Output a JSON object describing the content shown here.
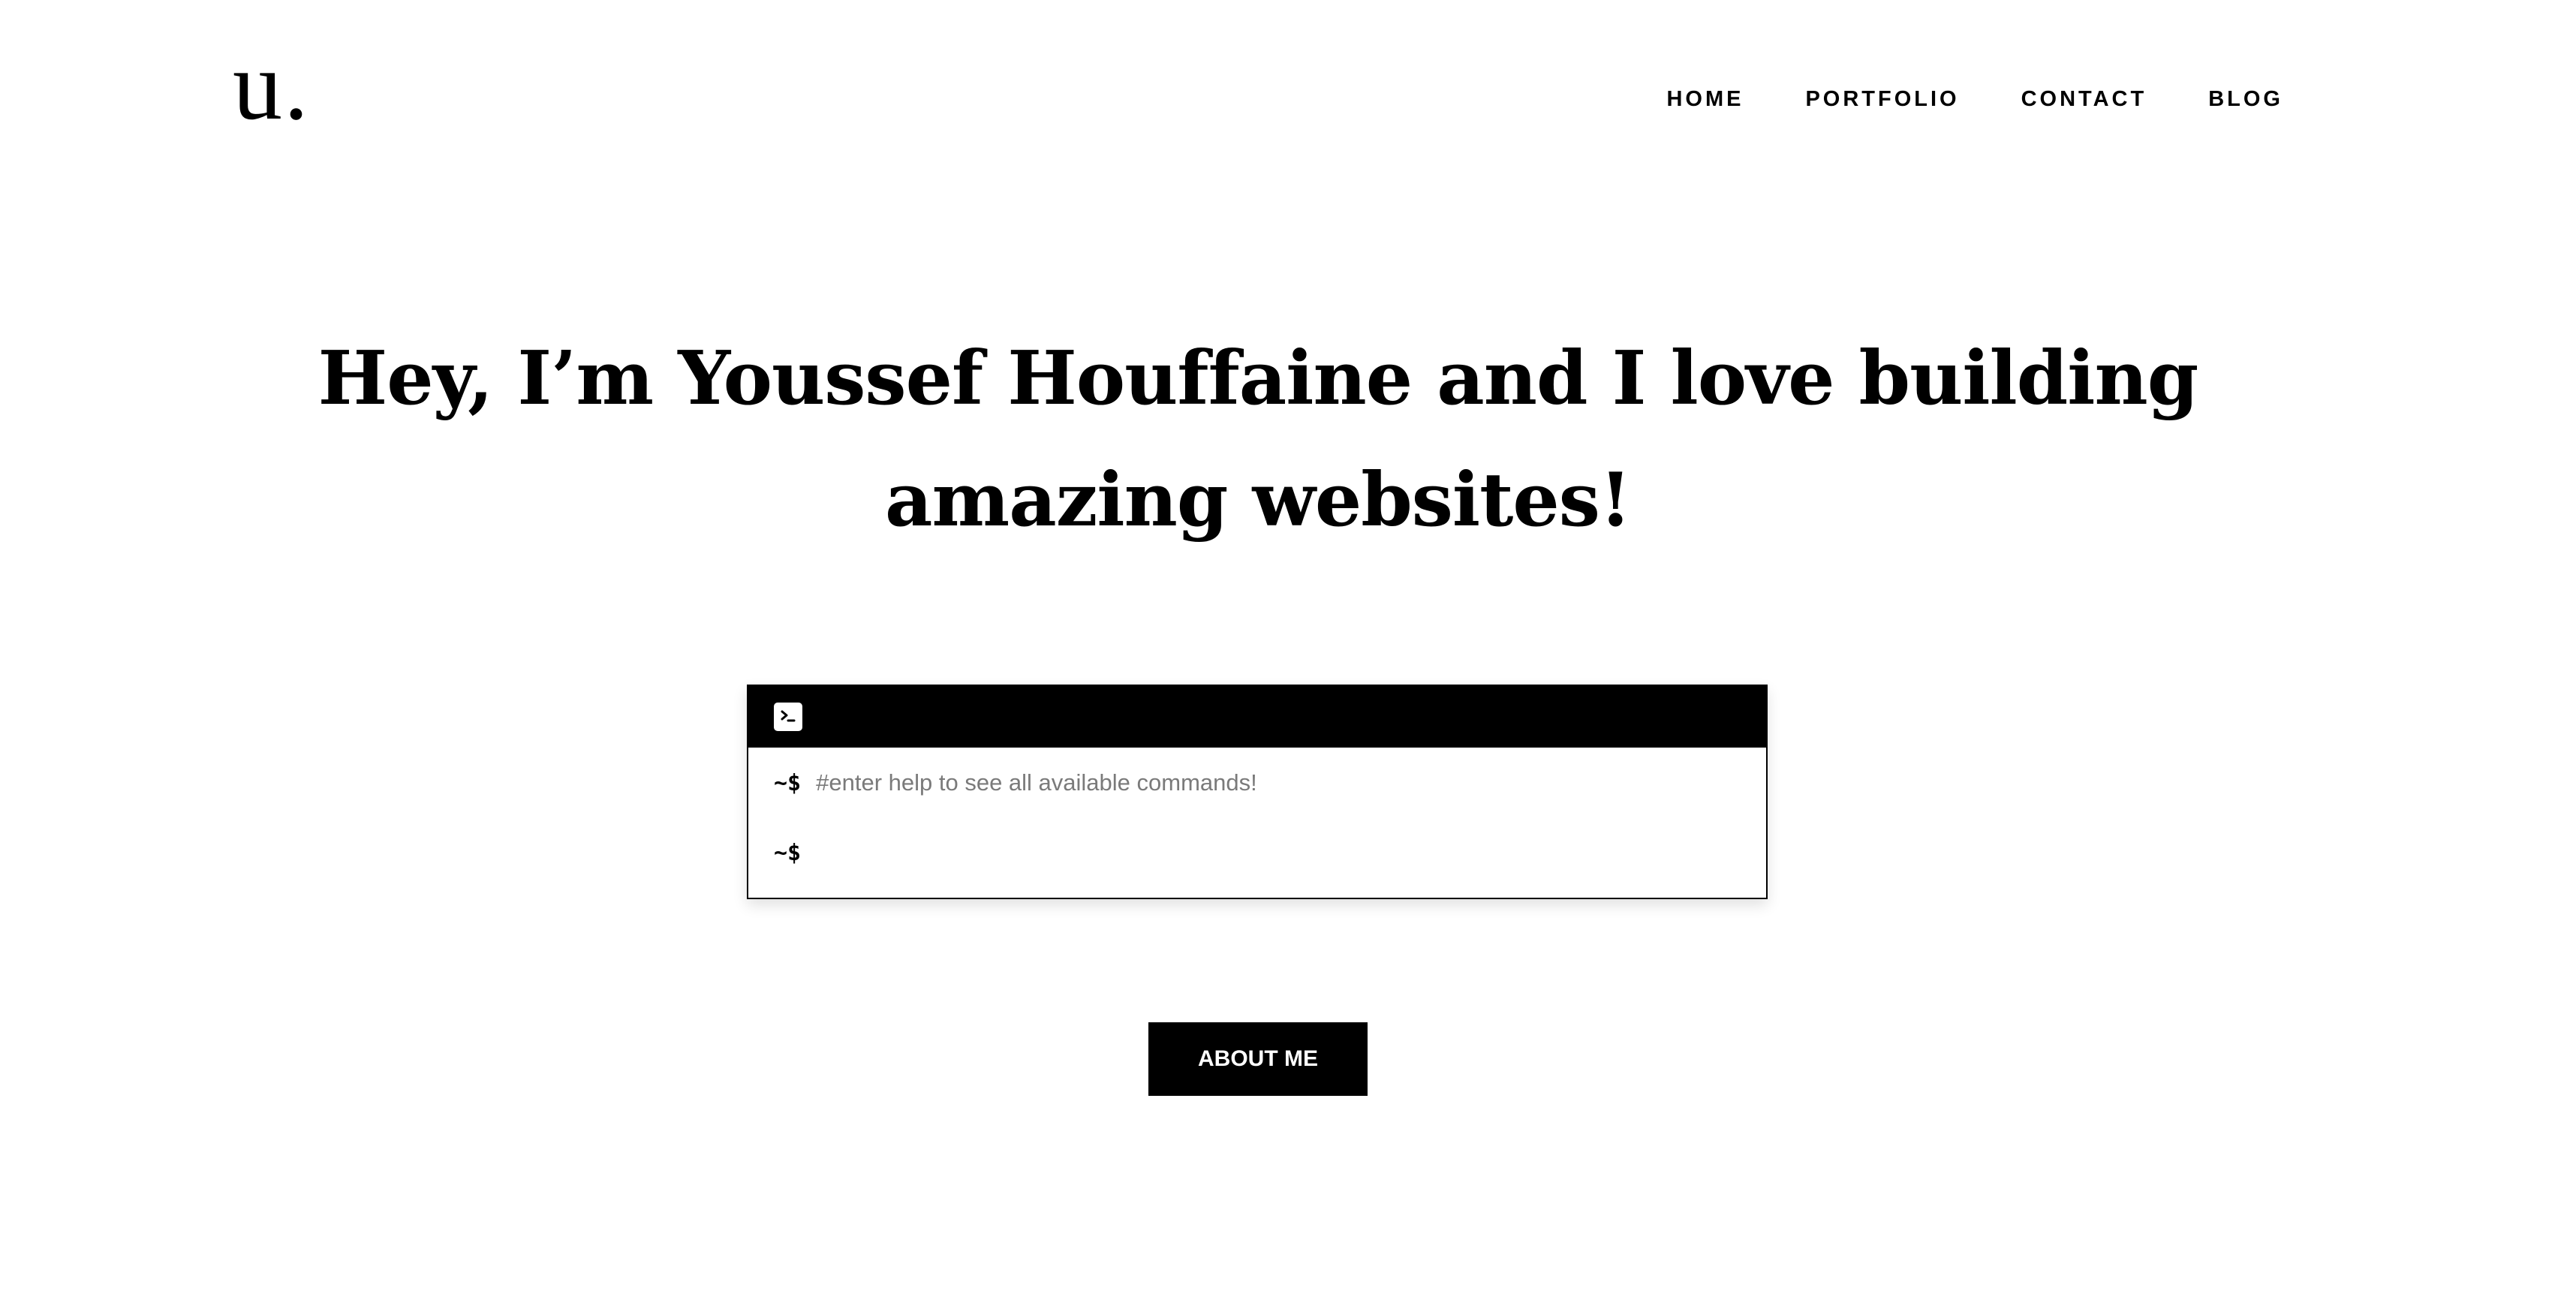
{
  "brand": {
    "logo_text": "u."
  },
  "nav": {
    "items": [
      {
        "label": "HOME"
      },
      {
        "label": "PORTFOLIO"
      },
      {
        "label": "CONTACT"
      },
      {
        "label": "BLOG"
      }
    ]
  },
  "hero": {
    "headline_line1": "Hey, I’m Youssef Houffaine and I love building",
    "headline_line2": "amazing websites!"
  },
  "terminal": {
    "icon": "terminal-icon",
    "prompt": "~$",
    "hint": "#enter help to see all available commands!",
    "input_placeholder": ""
  },
  "cta": {
    "about_label": "ABOUT ME"
  },
  "colors": {
    "background": "#ffffff",
    "text": "#000000",
    "hint": "#7a7a7a",
    "button_bg": "#000000",
    "button_text": "#ffffff"
  }
}
